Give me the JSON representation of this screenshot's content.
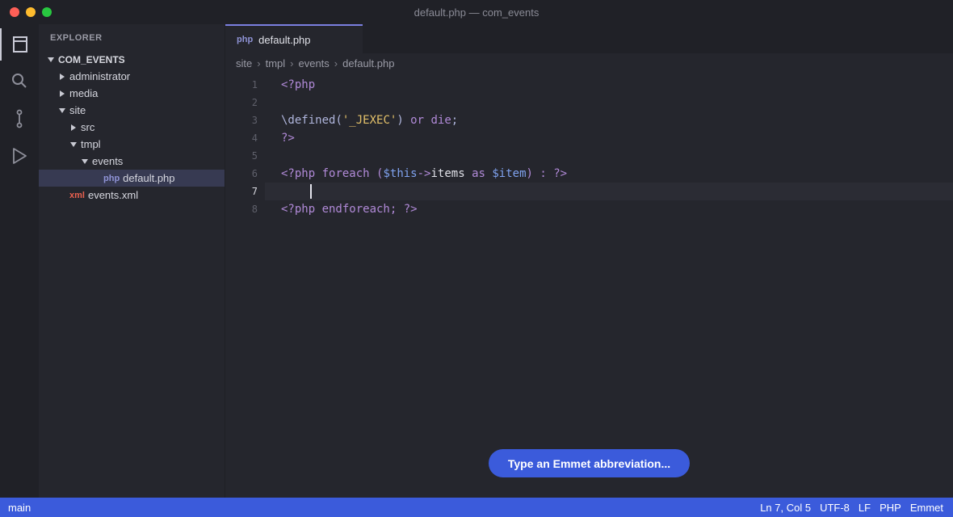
{
  "window": {
    "title": "default.php — com_events"
  },
  "activity_bar": {
    "items": [
      {
        "icon": "files-icon",
        "active": true
      },
      {
        "icon": "search-icon",
        "active": false
      },
      {
        "icon": "source-control-icon",
        "active": false
      },
      {
        "icon": "run-icon",
        "active": false
      }
    ]
  },
  "explorer": {
    "title": "EXPLORER",
    "root": "COM_EVENTS",
    "tree": [
      {
        "label": "administrator",
        "type": "folder",
        "expanded": false
      },
      {
        "label": "media",
        "type": "folder",
        "expanded": false
      },
      {
        "label": "site",
        "type": "folder",
        "expanded": true
      },
      {
        "label": "src",
        "type": "folder",
        "expanded": false
      },
      {
        "label": "tmpl",
        "type": "folder",
        "expanded": true
      },
      {
        "label": "events",
        "type": "folder",
        "expanded": true
      },
      {
        "label": "default.php",
        "type": "php",
        "badge": "php",
        "selected": true
      },
      {
        "label": "events.xml",
        "type": "xml",
        "badge": "xml"
      }
    ]
  },
  "tabs": [
    {
      "label": "default.php",
      "badge": "php",
      "active": true
    }
  ],
  "breadcrumb": [
    "site",
    "tmpl",
    "events",
    "default.php"
  ],
  "breadcrumb_separator": "›",
  "editor": {
    "current_line": 7,
    "lines": [
      {
        "num": "1",
        "text": "<?php"
      },
      {
        "num": "2",
        "text": ""
      },
      {
        "num": "3",
        "text": "\\defined('_JEXEC') or die;"
      },
      {
        "num": "4",
        "text": "?>"
      },
      {
        "num": "5",
        "text": ""
      },
      {
        "num": "6",
        "text": "<?php foreach ($this->items as $item) : ?>"
      },
      {
        "num": "7",
        "text": ""
      },
      {
        "num": "8",
        "text": "<?php endforeach; ?>"
      }
    ]
  },
  "emmet": {
    "prompt": "Type an Emmet abbreviation..."
  },
  "statusbar": {
    "branch": "main",
    "position": "Ln 7, Col 5",
    "encoding": "UTF-8",
    "eol": "LF",
    "language": "PHP",
    "extension": "Emmet"
  },
  "colors": {
    "accent": "#3b5bdb",
    "tab_border": "#7b7fe0",
    "selection": "#373a52"
  }
}
